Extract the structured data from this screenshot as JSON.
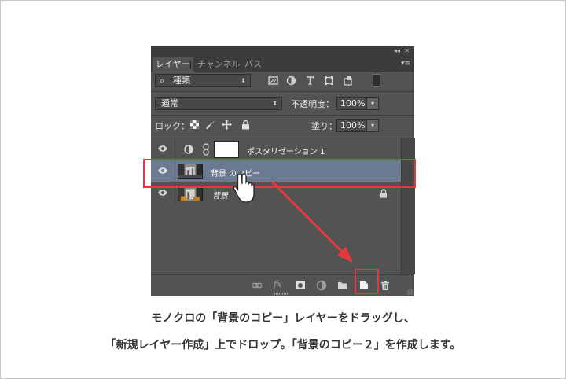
{
  "panel": {
    "tabs": [
      "レイヤー",
      "チャンネル",
      "パス"
    ],
    "filter_kind": "種類",
    "blend_mode": "通常",
    "opacity_label": "不透明度：",
    "opacity_value": "100%",
    "lock_label": "ロック：",
    "fill_label": "塗り：",
    "fill_value": "100%",
    "layers": [
      {
        "name": "ポスタリゼーション 1",
        "type": "adjustment",
        "selected": false
      },
      {
        "name": "背景 のコピー",
        "type": "image",
        "selected": true
      },
      {
        "name": "背景",
        "type": "image",
        "selected": false,
        "locked": true
      }
    ]
  },
  "caption": {
    "line1": "モノクロの「背景のコピー」レイヤーをドラッグし、",
    "line2": "「新規レイヤー作成」上でドロップ。「背景のコピー２」を作成します。"
  },
  "colors": {
    "highlight": "#e6393d",
    "selected_row": "#6b7a90",
    "panel_bg": "#535353"
  },
  "icons": [
    "eye-icon",
    "lock-icon",
    "link-icon",
    "fx-icon",
    "mask-icon",
    "adjustment-icon",
    "folder-icon",
    "new-layer-icon",
    "trash-icon",
    "hand-cursor-icon"
  ]
}
